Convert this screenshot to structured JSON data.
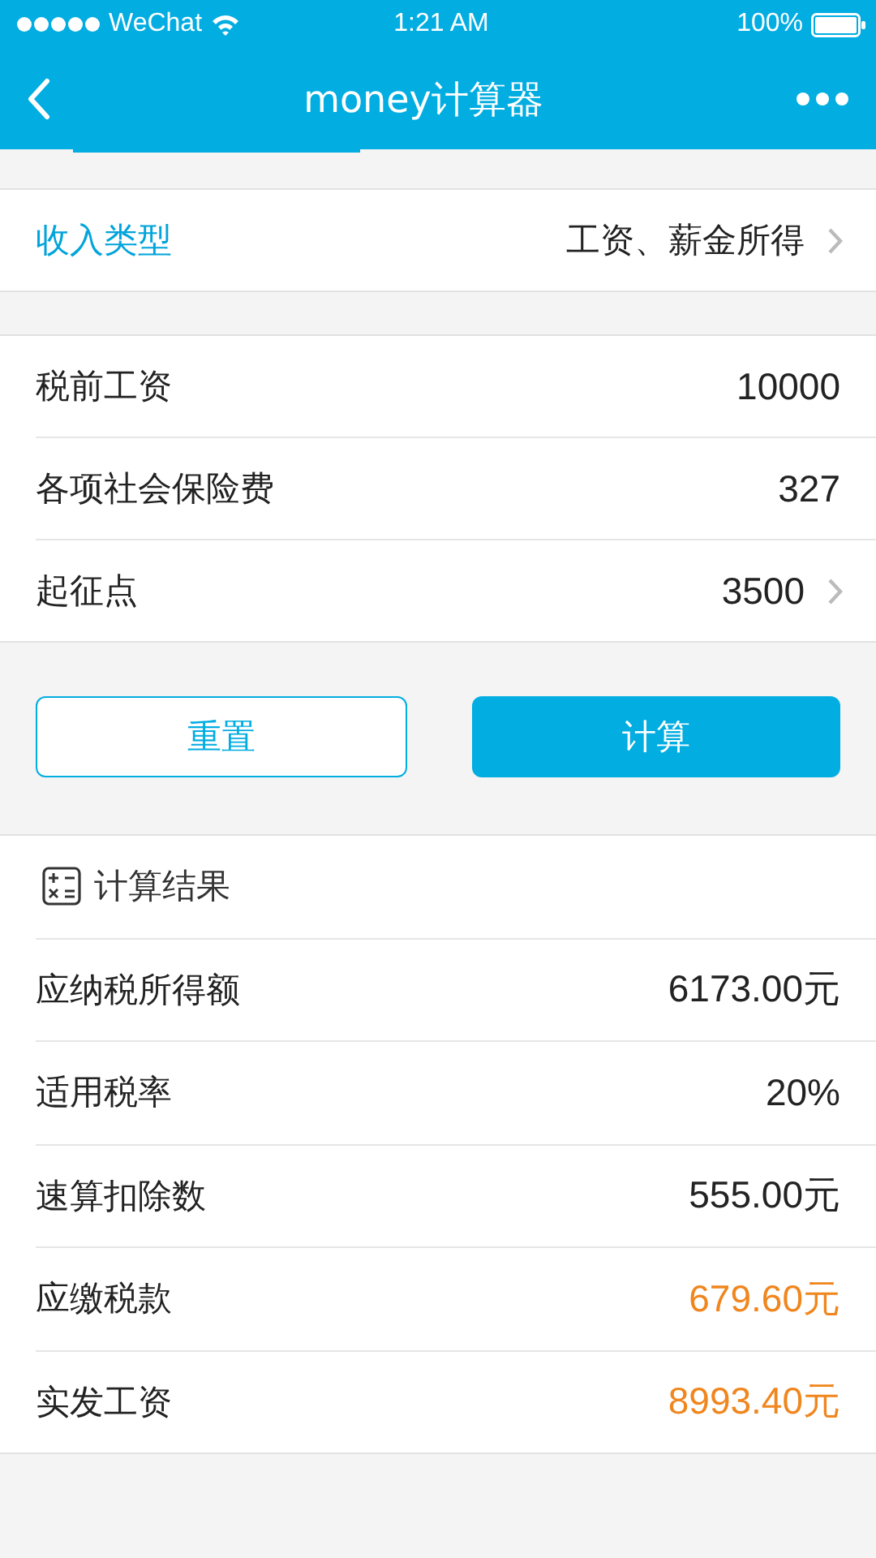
{
  "status_bar": {
    "carrier": "WeChat",
    "time": "1:21 AM",
    "battery": "100%"
  },
  "nav": {
    "title": "money计算器"
  },
  "income_type": {
    "label": "收入类型",
    "value": "工资、薪金所得"
  },
  "inputs": [
    {
      "label": "税前工资",
      "value": "10000",
      "arrow": false
    },
    {
      "label": "各项社会保险费",
      "value": "327",
      "arrow": false
    },
    {
      "label": "起征点",
      "value": "3500",
      "arrow": true
    }
  ],
  "buttons": [
    {
      "label": "重置",
      "kind": "outline"
    },
    {
      "label": "计算",
      "kind": "primary"
    }
  ],
  "results": {
    "title": "计算结果",
    "rows": [
      {
        "label": "应纳税所得额",
        "value": "6173.00元",
        "highlight": false
      },
      {
        "label": "适用税率",
        "value": "20%",
        "highlight": false
      },
      {
        "label": "速算扣除数",
        "value": "555.00元",
        "highlight": false
      },
      {
        "label": "应缴税款",
        "value": "679.60元",
        "highlight": true
      },
      {
        "label": "实发工资",
        "value": "8993.40元",
        "highlight": true
      }
    ]
  }
}
